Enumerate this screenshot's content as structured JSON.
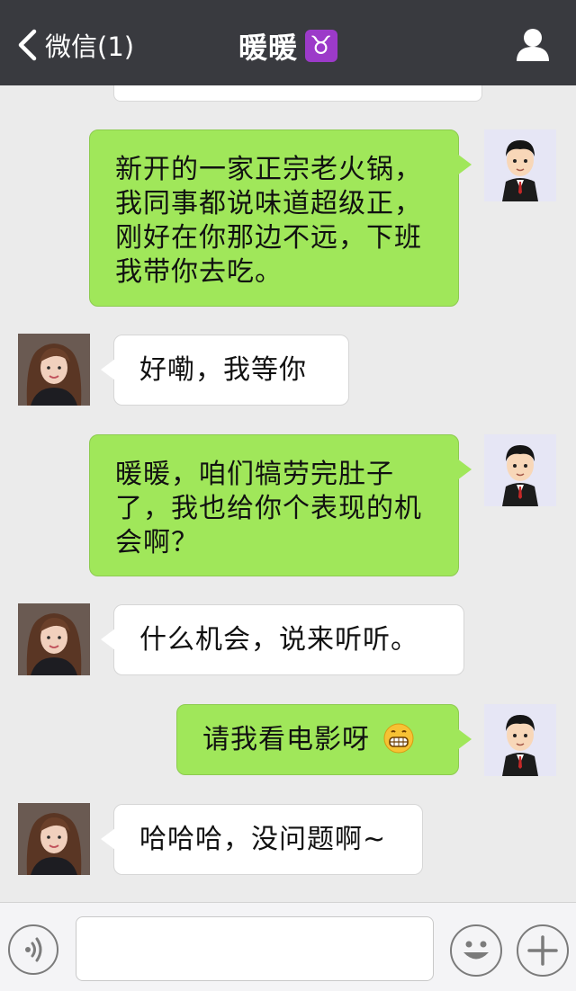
{
  "header": {
    "back_label": "微信(1)",
    "title": "暖暖",
    "zodiac_symbol": "♉",
    "background": "#393a3f"
  },
  "messages": [
    {
      "side": "out",
      "text": "新开的一家正宗老火锅，我同事都说味道超级正，刚好在你那边不远，下班我带你去吃。"
    },
    {
      "side": "in",
      "text": "好嘞，我等你"
    },
    {
      "side": "out",
      "text": "暖暖，咱们犒劳完肚子了，我也给你个表现的机会啊？"
    },
    {
      "side": "in",
      "text": "什么机会，说来听听。"
    },
    {
      "side": "out",
      "text": "请我看电影呀",
      "emoji": "grinning-face"
    },
    {
      "side": "in",
      "text": "哈哈哈，没问题啊~"
    }
  ],
  "colors": {
    "outgoing_bubble": "#a0e75a",
    "incoming_bubble": "#ffffff",
    "chat_background": "#ebebeb"
  },
  "input_bar": {
    "value": "",
    "icons": [
      "voice-icon",
      "emoji-icon",
      "plus-icon"
    ]
  }
}
